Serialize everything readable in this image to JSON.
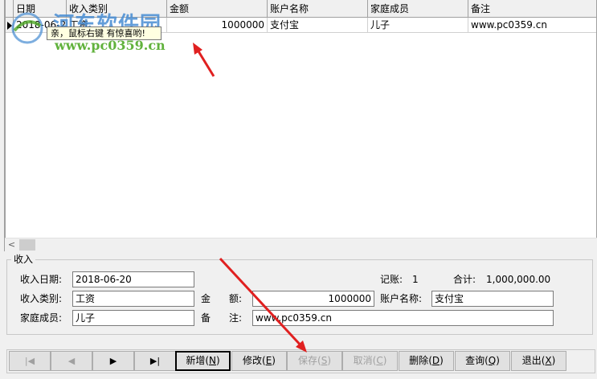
{
  "grid": {
    "columns": [
      "日期",
      "收入类别",
      "金额",
      "账户名称",
      "家庭成员",
      "备注"
    ],
    "rows": [
      {
        "date": "2018-06-20",
        "category": "工资",
        "amount": "1000000",
        "account": "支付宝",
        "member": "儿子",
        "note": "www.pc0359.cn"
      }
    ],
    "tooltip": "亲，鼠标右键 有惊喜哟!",
    "scroll_left": "<"
  },
  "watermark": {
    "title": "河东软件园",
    "url": "www.pc0359.cn"
  },
  "form": {
    "legend": "收入",
    "date_label": "收入日期:",
    "date_value": "2018-06-20",
    "category_label": "收入类别:",
    "category_value": "工资",
    "member_label": "家庭成员:",
    "member_value": "儿子",
    "amount_label_1": "金",
    "amount_label_2": "额:",
    "amount_value": "1000000",
    "note_label_1": "备",
    "note_label_2": "注:",
    "note_value": "www.pc0359.cn",
    "account_label": "账户名称:",
    "account_value": "支付宝",
    "records_label": "记账:",
    "records_value": "1",
    "total_label": "合计:",
    "total_value": "1,000,000.00"
  },
  "nav": {
    "first": "|◀",
    "prev": "◀",
    "next": "▶",
    "last": "▶|"
  },
  "toolbar": {
    "new": {
      "text": "新增",
      "key": "N"
    },
    "edit": {
      "text": "修改",
      "key": "E"
    },
    "save": {
      "text": "保存",
      "key": "S"
    },
    "cancel": {
      "text": "取消",
      "key": "C"
    },
    "delete": {
      "text": "删除",
      "key": "D"
    },
    "query": {
      "text": "查询",
      "key": "Q"
    },
    "exit": {
      "text": "退出",
      "key": "X"
    }
  },
  "colors": {
    "arrow": "#e02020",
    "tooltip_bg": "#ffffe1"
  }
}
